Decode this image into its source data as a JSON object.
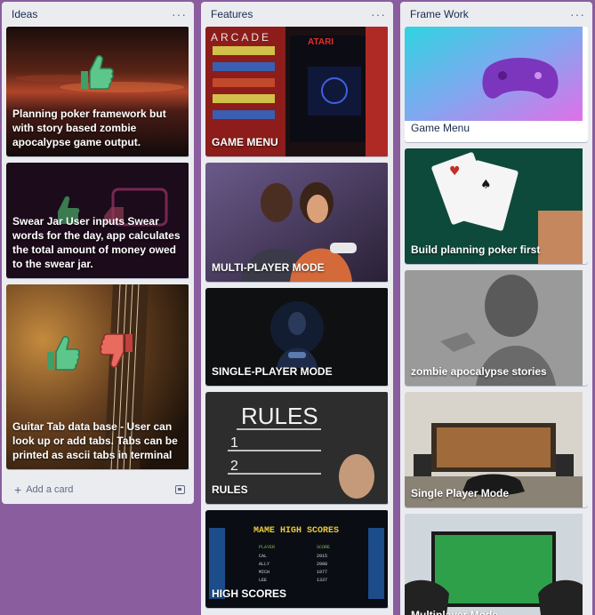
{
  "lists": [
    {
      "title": "Ideas",
      "cards": [
        "Planning poker framework but with story based zombie apocalypse game output.",
        "Swear Jar User inputs Swear words for the day, app calculates the total amount of money owed to the swear jar.",
        "Guitar Tab data base - User can look up or add tabs. Tabs can be printed as ascii tabs in terminal"
      ],
      "add_card_label": "Add a card"
    },
    {
      "title": "Features",
      "cards": [
        "GAME MENU",
        "MULTI-PLAYER MODE",
        "SINGLE-PLAYER MODE",
        "RULES",
        "HIGH SCORES"
      ],
      "arcade_text": "ARCADE",
      "atari_text": "ATARI",
      "rules_text": "RULES",
      "rules_items": [
        "1",
        "2"
      ],
      "scores_heading": "MAME HIGH SCORES",
      "scores_columns": [
        "PLAYER",
        "SCORE"
      ],
      "scores_rows": [
        [
          "CAL",
          "2015"
        ],
        [
          "ALLY",
          "2008"
        ],
        [
          "MICH",
          "1977"
        ],
        [
          "LEE",
          "1337"
        ]
      ]
    },
    {
      "title": "Frame Work",
      "cards": [
        "Game Menu",
        "Build planning poker first",
        "zombie apocalypse stories",
        "Single Player Mode",
        "Multiplayer Mode"
      ]
    }
  ]
}
